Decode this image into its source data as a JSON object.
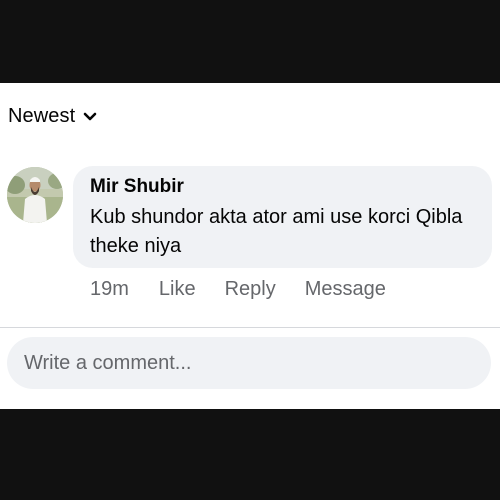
{
  "sort": {
    "label": "Newest",
    "icon": "chevron-down-icon"
  },
  "comment": {
    "author": "Mir Shubir",
    "text": "Kub shundor akta ator ami use korci Qibla theke niya",
    "time": "19m",
    "actions": {
      "like": "Like",
      "reply": "Reply",
      "message": "Message"
    }
  },
  "composer": {
    "placeholder": "Write a comment..."
  },
  "colors": {
    "background": "#111111",
    "panel": "#ffffff",
    "bubble": "#f0f2f5",
    "secondary_text": "#65676b",
    "primary_text": "#050505"
  }
}
